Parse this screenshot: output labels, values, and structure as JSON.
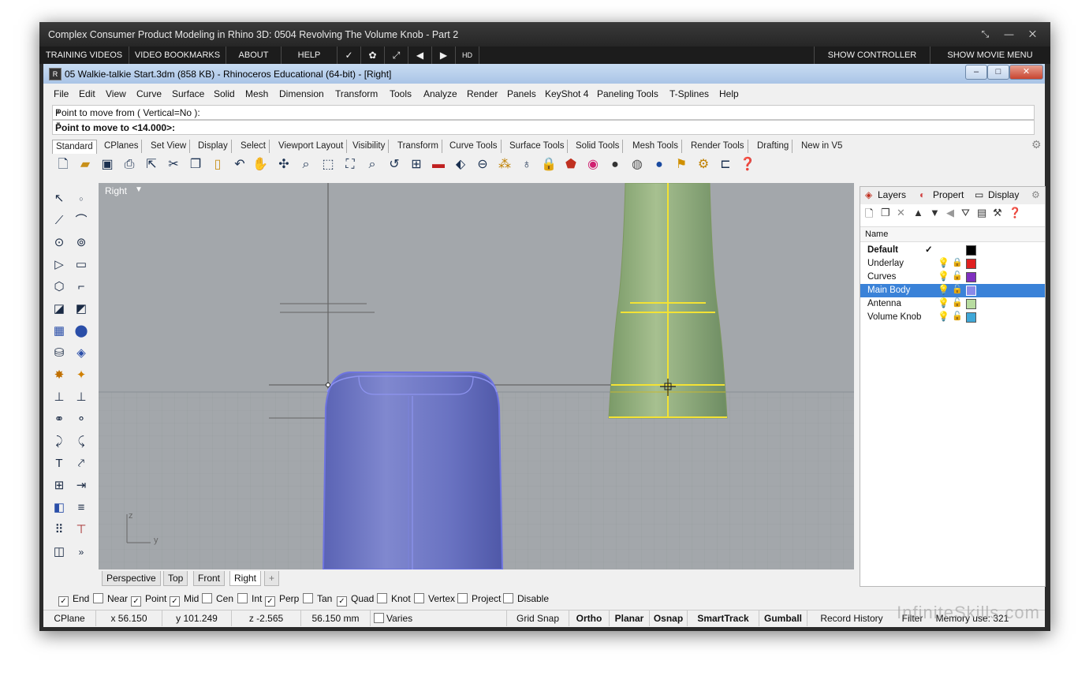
{
  "player": {
    "title": "Complex Consumer Product Modeling in Rhino 3D: 0504 Revolving The Volume Knob - Part 2",
    "controls": "⤡ — ✕",
    "menu": [
      "TRAINING VIDEOS",
      "VIDEO BOOKMARKS",
      "ABOUT",
      "HELP"
    ],
    "icons": [
      "✓",
      "✿",
      "⤢",
      "◀",
      "▶",
      "HD"
    ],
    "show_controller": "SHOW CONTROLLER",
    "show_movie_menu": "SHOW MOVIE MENU"
  },
  "rhino": {
    "title": "05 Walkie-talkie Start.3dm (858 KB) - Rhinoceros Educational (64-bit) - [Right]",
    "menu": [
      "File",
      "Edit",
      "View",
      "Curve",
      "Surface",
      "Solid",
      "Mesh",
      "Dimension",
      "Transform",
      "Tools",
      "Analyze",
      "Render",
      "Panels",
      "KeyShot 4",
      "Paneling Tools",
      "T-Splines",
      "Help"
    ],
    "command_history": "Point to move from ( Vertical=No ):",
    "command_prompt": "Point to move to <14.000>:",
    "toolbar_tabs": [
      "Standard",
      "CPlanes",
      "Set View",
      "Display",
      "Select",
      "Viewport Layout",
      "Visibility",
      "Transform",
      "Curve Tools",
      "Surface Tools",
      "Solid Tools",
      "Mesh Tools",
      "Render Tools",
      "Drafting",
      "New in V5"
    ],
    "viewport": {
      "label": "Right",
      "axis_z": "z",
      "axis_y": "y"
    },
    "viewport_tabs": [
      "Perspective",
      "Top",
      "Front",
      "Right",
      "+"
    ],
    "panel": {
      "tabs": [
        "Layers",
        "Propert",
        "Display"
      ],
      "name_header": "Name",
      "layers": [
        {
          "name": "Default",
          "color": "#000000",
          "current": true
        },
        {
          "name": "Underlay",
          "color": "#e02020",
          "locked": true
        },
        {
          "name": "Curves",
          "color": "#8030c0"
        },
        {
          "name": "Main Body",
          "color": "#8a8ae8",
          "selected": true
        },
        {
          "name": "Antenna",
          "color": "#b8dca0"
        },
        {
          "name": "Volume Knob",
          "color": "#40a8d8"
        }
      ]
    },
    "osnaps": [
      {
        "label": "End",
        "checked": true
      },
      {
        "label": "Near",
        "checked": false
      },
      {
        "label": "Point",
        "checked": true
      },
      {
        "label": "Mid",
        "checked": true
      },
      {
        "label": "Cen",
        "checked": false
      },
      {
        "label": "Int",
        "checked": false
      },
      {
        "label": "Perp",
        "checked": true
      },
      {
        "label": "Tan",
        "checked": false
      },
      {
        "label": "Quad",
        "checked": true
      },
      {
        "label": "Knot",
        "checked": false
      },
      {
        "label": "Vertex",
        "checked": false
      },
      {
        "label": "Project",
        "checked": false
      },
      {
        "label": "Disable",
        "checked": false
      }
    ],
    "status": {
      "cplane": "CPlane",
      "x": "x 56.150",
      "y": "y 101.249",
      "z": "z -2.565",
      "distance": "56.150 mm",
      "layer": "Varies",
      "grid_snap": "Grid Snap",
      "ortho": "Ortho",
      "planar": "Planar",
      "osnap": "Osnap",
      "smarttrack": "SmartTrack",
      "gumball": "Gumball",
      "record_history": "Record History",
      "filter": "Filter",
      "memory": "Memory use: 321"
    },
    "watermark": "InfiniteSkills.com"
  }
}
